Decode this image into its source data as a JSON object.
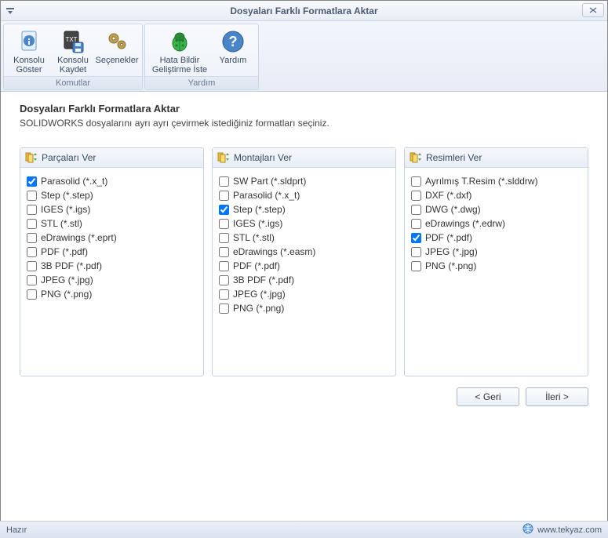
{
  "window": {
    "title": "Dosyaları Farklı Formatlara Aktar"
  },
  "ribbon": {
    "groups": [
      {
        "title": "Komutlar",
        "items": [
          {
            "name": "show-console",
            "label": "Konsolu\nGöster",
            "icon": "info-doc"
          },
          {
            "name": "save-console",
            "label": "Konsolu\nKaydet",
            "icon": "txt-save"
          },
          {
            "name": "options",
            "label": "Seçenekler",
            "icon": "gears"
          }
        ]
      },
      {
        "title": "Yardım",
        "items": [
          {
            "name": "bug-report",
            "label": "Hata Bildir\nGeliştirme İste",
            "icon": "bug"
          },
          {
            "name": "help",
            "label": "Yardım",
            "icon": "help"
          }
        ]
      }
    ]
  },
  "content": {
    "heading": "Dosyaları Farklı Formatlara Aktar",
    "subtitle": "SOLIDWORKS dosyalarını ayrı ayrı çevirmek istediğiniz formatları seçiniz."
  },
  "panels": [
    {
      "name": "parts",
      "title": "Parçaları Ver",
      "items": [
        {
          "label": "Parasolid (*.x_t)",
          "checked": true
        },
        {
          "label": "Step (*.step)",
          "checked": false
        },
        {
          "label": "IGES (*.igs)",
          "checked": false
        },
        {
          "label": "STL (*.stl)",
          "checked": false
        },
        {
          "label": "eDrawings (*.eprt)",
          "checked": false
        },
        {
          "label": "PDF (*.pdf)",
          "checked": false
        },
        {
          "label": "3B PDF (*.pdf)",
          "checked": false
        },
        {
          "label": "JPEG (*.jpg)",
          "checked": false
        },
        {
          "label": "PNG (*.png)",
          "checked": false
        }
      ]
    },
    {
      "name": "assemblies",
      "title": "Montajları Ver",
      "items": [
        {
          "label": "SW Part (*.sldprt)",
          "checked": false
        },
        {
          "label": "Parasolid (*.x_t)",
          "checked": false
        },
        {
          "label": "Step (*.step)",
          "checked": true
        },
        {
          "label": "IGES (*.igs)",
          "checked": false
        },
        {
          "label": "STL (*.stl)",
          "checked": false
        },
        {
          "label": "eDrawings (*.easm)",
          "checked": false
        },
        {
          "label": "PDF (*.pdf)",
          "checked": false
        },
        {
          "label": "3B PDF (*.pdf)",
          "checked": false
        },
        {
          "label": "JPEG (*.jpg)",
          "checked": false
        },
        {
          "label": "PNG (*.png)",
          "checked": false
        }
      ]
    },
    {
      "name": "drawings",
      "title": "Resimleri Ver",
      "items": [
        {
          "label": "Ayrılmış T.Resim (*.slddrw)",
          "checked": false
        },
        {
          "label": "DXF (*.dxf)",
          "checked": false
        },
        {
          "label": "DWG (*.dwg)",
          "checked": false
        },
        {
          "label": "eDrawings (*.edrw)",
          "checked": false
        },
        {
          "label": "PDF (*.pdf)",
          "checked": true
        },
        {
          "label": "JPEG (*.jpg)",
          "checked": false
        },
        {
          "label": "PNG (*.png)",
          "checked": false
        }
      ]
    }
  ],
  "buttons": {
    "back": "< Geri",
    "next": "İleri >"
  },
  "status": {
    "ready": "Hazır",
    "link": "www.tekyaz.com"
  }
}
